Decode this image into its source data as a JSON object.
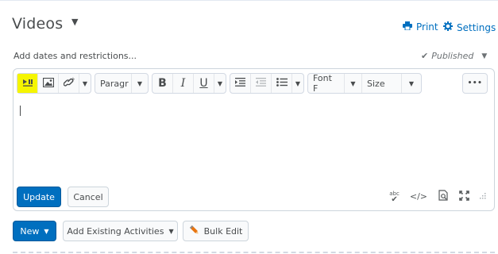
{
  "header": {
    "title": "Videos",
    "print_label": "Print",
    "settings_label": "Settings"
  },
  "subheader": {
    "dates_link": "Add dates and restrictions...",
    "status": "Published"
  },
  "toolbar": {
    "block_select": "Paragr",
    "bold": "B",
    "italic": "I",
    "underline": "U",
    "font_select": "Font F",
    "size_select": "Size",
    "more": "•••"
  },
  "editor": {
    "update_label": "Update",
    "cancel_label": "Cancel",
    "spellcheck_text": "abc",
    "code_view_text": "</>"
  },
  "bottom": {
    "new_label": "New",
    "existing_label": "Add Existing Activities",
    "bulk_label": "Bulk Edit"
  },
  "colors": {
    "accent": "#006fbf",
    "highlight": "#f5f500",
    "text": "#494c4e",
    "border": "#cdd5dc"
  }
}
